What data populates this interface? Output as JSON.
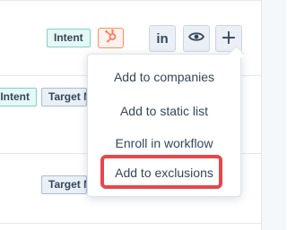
{
  "rows": [
    {
      "tags": [
        {
          "label": "Intent",
          "kind": "intent"
        }
      ],
      "actions": {
        "hubspot_icon": "hubspot-sprocket-icon",
        "linkedin_label": "in",
        "linkedin_icon": "linkedin-icon",
        "view_icon": "eye-icon",
        "add_label": "+",
        "add_icon": "plus-icon"
      }
    },
    {
      "tags": [
        {
          "label": "Intent",
          "kind": "intent"
        },
        {
          "label": "Target Market",
          "kind": "target"
        }
      ]
    },
    {
      "tags": [
        {
          "label": "Target Market",
          "kind": "target"
        }
      ]
    }
  ],
  "dropdown_menu": {
    "items": [
      {
        "label": "Add to companies",
        "highlighted": false
      },
      {
        "label": "Add to static list",
        "highlighted": false
      },
      {
        "label": "Enroll in workflow",
        "highlighted": false
      },
      {
        "label": "Add to exclusions",
        "highlighted": true
      }
    ]
  },
  "colors": {
    "text": "#33475b",
    "intent_tag_bg": "#e5f8f6",
    "intent_tag_border": "#7fd1c8",
    "target_tag_bg": "#eaf0f6",
    "target_tag_border": "#a9bdd3",
    "hubspot_orange": "#ff7a59",
    "highlight_red": "#e8474a"
  }
}
